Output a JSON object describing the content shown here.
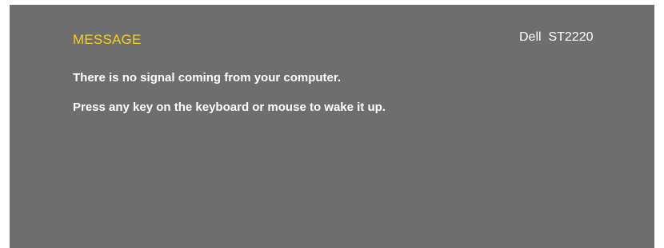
{
  "osd": {
    "title": "MESSAGE",
    "model": "Dell  ST2220",
    "lines": [
      "There is no signal coming from your computer.",
      "Press any key on the keyboard or mouse to wake it up."
    ],
    "colors": {
      "panel_background": "#6e6e6e",
      "title": "#f2d31b",
      "text": "#ffffff"
    }
  }
}
